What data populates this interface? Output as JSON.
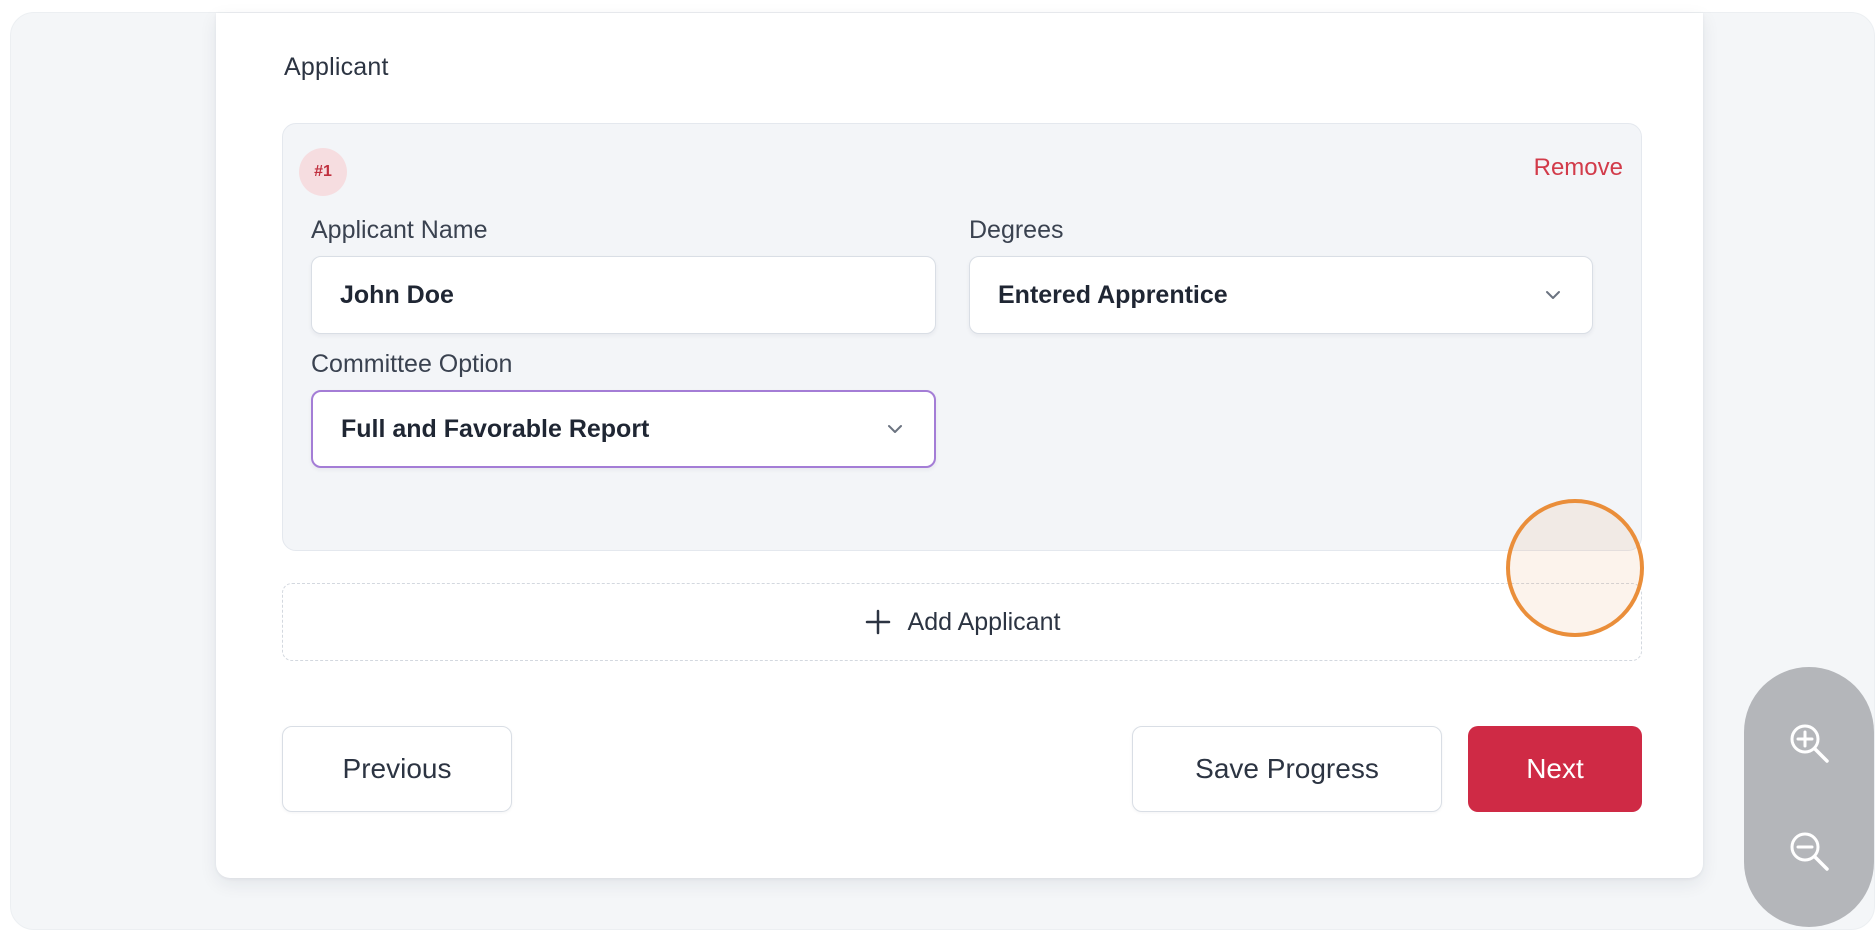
{
  "section": {
    "title": "Applicant"
  },
  "applicant": {
    "badge": "#1",
    "remove_label": "Remove",
    "name_label": "Applicant Name",
    "name_value": "John Doe",
    "degrees_label": "Degrees",
    "degrees_value": "Entered Apprentice",
    "committee_label": "Committee Option",
    "committee_value": "Full and Favorable Report"
  },
  "add_applicant_label": "Add Applicant",
  "footer": {
    "previous_label": "Previous",
    "save_label": "Save Progress",
    "next_label": "Next"
  },
  "icons": {
    "plus": "plus-icon",
    "chevron": "chevron-down-icon",
    "zoom_in": "zoom-in-icon",
    "zoom_out": "zoom-out-icon"
  },
  "colors": {
    "accent": "#cf2a45",
    "remove": "#d23b4a",
    "focus": "#a47dd6",
    "click_indicator": "#ea8e3a"
  }
}
